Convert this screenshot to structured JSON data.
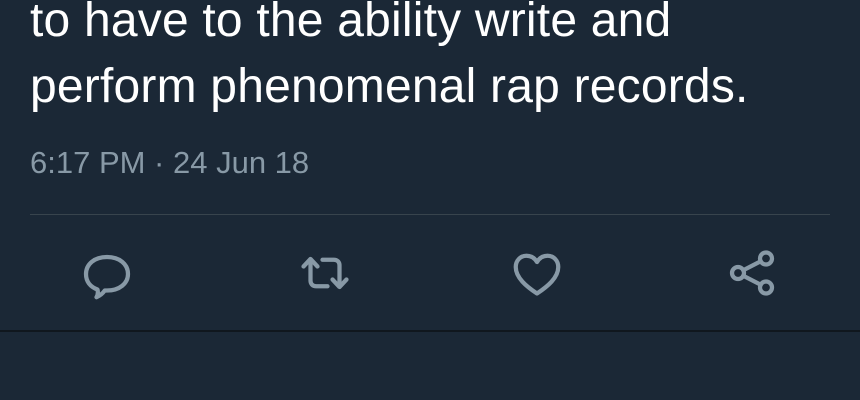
{
  "tweet": {
    "lines": [
      "to have to the ability write and",
      "perform phenomenal rap records."
    ],
    "timestamp": "6:17 PM · 24 Jun 18"
  },
  "actions": {
    "reply_icon": "reply-icon",
    "retweet_icon": "retweet-icon",
    "like_icon": "heart-icon",
    "share_icon": "share-icon",
    "icon_color": "#8899a6"
  },
  "colors": {
    "background": "#1b2836",
    "text": "#ffffff",
    "muted": "#8899a6",
    "divider": "#38444d"
  }
}
